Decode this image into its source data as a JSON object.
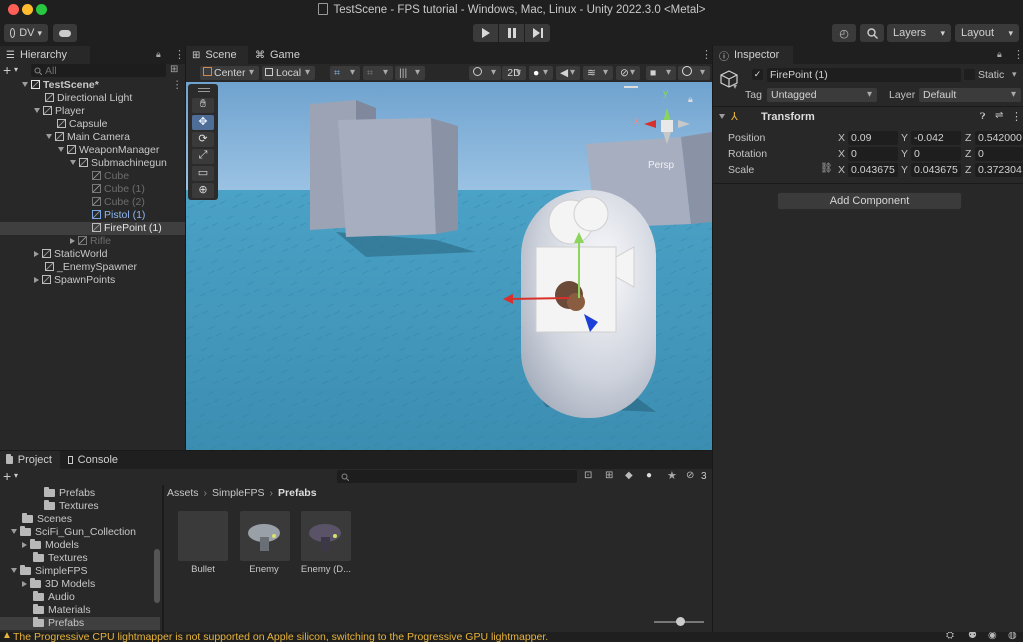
{
  "window": {
    "title": "TestScene - FPS tutorial - Windows, Mac, Linux - Unity 2022.3.0 <Metal>"
  },
  "toolbar": {
    "account": "DV",
    "layers": "Layers",
    "layout": "Layout"
  },
  "hierarchy": {
    "tab": "Hierarchy",
    "search_placeholder": "All",
    "items": [
      {
        "label": "TestScene*",
        "indent": 0
      },
      {
        "label": "Directional Light",
        "indent": 1
      },
      {
        "label": "Player",
        "indent": 1
      },
      {
        "label": "Capsule",
        "indent": 2
      },
      {
        "label": "Main Camera",
        "indent": 2
      },
      {
        "label": "WeaponManager",
        "indent": 3
      },
      {
        "label": "Submachinegun",
        "indent": 4
      },
      {
        "label": "Cube",
        "indent": 5
      },
      {
        "label": "Cube (1)",
        "indent": 5
      },
      {
        "label": "Cube (2)",
        "indent": 5
      },
      {
        "label": "Pistol (1)",
        "indent": 5
      },
      {
        "label": "FirePoint (1)",
        "indent": 5
      },
      {
        "label": "Rifle",
        "indent": 4
      },
      {
        "label": "StaticWorld",
        "indent": 1
      },
      {
        "label": "_EnemySpawner",
        "indent": 1
      },
      {
        "label": "SpawnPoints",
        "indent": 1
      }
    ]
  },
  "scene": {
    "tab_scene": "Scene",
    "tab_game": "Game",
    "pivot": "Center",
    "space": "Local",
    "mode_2d": "2D",
    "persp": "Persp",
    "gizmo_y": "y",
    "gizmo_x": "x"
  },
  "inspector": {
    "tab": "Inspector",
    "object_name": "FirePoint (1)",
    "static_label": "Static",
    "tag_label": "Tag",
    "tag_value": "Untagged",
    "layer_label": "Layer",
    "layer_value": "Default",
    "component": "Transform",
    "position_label": "Position",
    "rotation_label": "Rotation",
    "scale_label": "Scale",
    "axis_x": "X",
    "axis_y": "Y",
    "axis_z": "Z",
    "position": {
      "x": "0.09",
      "y": "-0.042",
      "z": "0.542000"
    },
    "rotation": {
      "x": "0",
      "y": "0",
      "z": "0"
    },
    "scale": {
      "x": "0.043675",
      "y": "0.043675",
      "z": "0.372304"
    },
    "add_component": "Add Component"
  },
  "project": {
    "tab_project": "Project",
    "tab_console": "Console",
    "hidden_count": "3",
    "breadcrumb": [
      "Assets",
      "SimpleFPS",
      "Prefabs"
    ],
    "tree": [
      {
        "label": "Prefabs",
        "indent": 2
      },
      {
        "label": "Textures",
        "indent": 2
      },
      {
        "label": "Scenes",
        "indent": 1
      },
      {
        "label": "SciFi_Gun_Collection",
        "indent": 1
      },
      {
        "label": "Models",
        "indent": 2
      },
      {
        "label": "Textures",
        "indent": 2
      },
      {
        "label": "SimpleFPS",
        "indent": 1
      },
      {
        "label": "3D Models",
        "indent": 2
      },
      {
        "label": "Audio",
        "indent": 2
      },
      {
        "label": "Materials",
        "indent": 2
      },
      {
        "label": "Prefabs",
        "indent": 2
      }
    ],
    "assets": [
      {
        "name": "Bullet"
      },
      {
        "name": "Enemy"
      },
      {
        "name": "Enemy (D..."
      }
    ]
  },
  "status": {
    "message": "The Progressive CPU lightmapper is not supported on Apple silicon, switching to the Progressive GPU lightmapper."
  },
  "colors": {
    "accent_select": "#3f3f3f",
    "warning": "#e8b43a",
    "sky": "#6da8d8",
    "floor": "#3c93b8"
  }
}
